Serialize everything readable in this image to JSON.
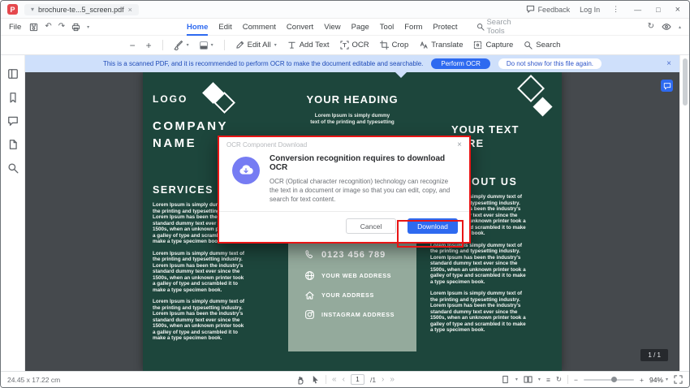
{
  "icons": {
    "logo_letter": "P",
    "caret_down": "▾",
    "caret_up": "▴",
    "close": "×",
    "kebab": "⋮",
    "minimize": "—",
    "maximize": "□",
    "undo": "↶",
    "redo": "↷",
    "sync": "↻",
    "minus": "−",
    "plus": "+",
    "nav_first": "«",
    "nav_prev": "‹",
    "nav_next": "›",
    "nav_last": "»",
    "hamburger": "≡"
  },
  "titlebar": {
    "tab_title": "brochure-te...5_screen.pdf",
    "feedback": "Feedback",
    "login": "Log In"
  },
  "menubar": {
    "file": "File",
    "menus": [
      "Home",
      "Edit",
      "Comment",
      "Convert",
      "View",
      "Page",
      "Tool",
      "Form",
      "Protect"
    ],
    "search_tools": "Search Tools"
  },
  "toolbar": {
    "edit_all": "Edit All",
    "add_text": "Add Text",
    "ocr": "OCR",
    "crop": "Crop",
    "translate": "Translate",
    "capture": "Capture",
    "search": "Search"
  },
  "notification": {
    "message": "This is a scanned PDF, and it is recommended to perform OCR to make the document editable and searchable.",
    "perform_button": "Perform OCR",
    "dismiss_button": "Do not show for this file again."
  },
  "dialog": {
    "title": "OCR Component Download",
    "heading": "Conversion recognition requires to download OCR",
    "body": "OCR (Optical character recognition) technology can recognize the text in a document or image so that you can edit, copy, and search for text content.",
    "cancel": "Cancel",
    "download": "Download"
  },
  "doc": {
    "left": {
      "logo": "LOGO",
      "company1": "COMPANY",
      "company2": "NAME",
      "services": "SERVICES"
    },
    "middle": {
      "heading": "YOUR HEADING",
      "intro": "Lorem Ipsum is simply dummy text of the printing and typesetting",
      "phone": "0123 456 789",
      "web": "YOUR WEB ADDRESS",
      "address": "YOUR ADDRESS",
      "instagram": "INSTAGRAM ADDRESS"
    },
    "right": {
      "heading1": "YOUR TEXT",
      "heading2": "HERE",
      "about": "ABOUT US"
    },
    "lorem": "Lorem Ipsum is simply dummy text of the printing and typesetting industry. Lorem Ipsum has been the industry's standard dummy text ever since the 1500s, when an unknown printer took a galley of type and scrambled it to make a type specimen book."
  },
  "statusbar": {
    "dimensions": "24.45 x 17.22 cm",
    "page_current": "1",
    "page_total": "/1",
    "zoom": "94%",
    "page_badge": "1 / 1"
  },
  "colors": {
    "accent_blue": "#2e6af0",
    "annotation_red": "#e81515",
    "brochure_dark": "#1d463c",
    "brochure_sage": "#94aa9c",
    "notification_bg": "#cfe0fb"
  }
}
